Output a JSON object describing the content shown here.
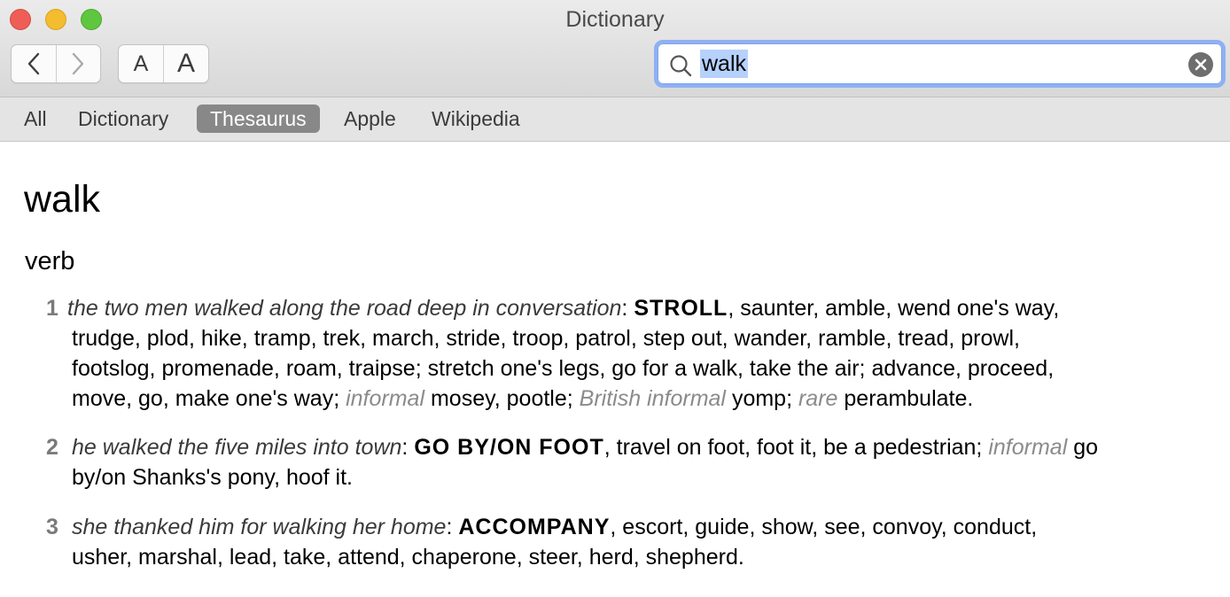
{
  "window": {
    "title": "Dictionary"
  },
  "toolbar": {
    "font_small_label": "A",
    "font_large_label": "A"
  },
  "search": {
    "value": "walk"
  },
  "tabs": [
    {
      "label": "All",
      "active": false
    },
    {
      "label": "Dictionary",
      "active": false
    },
    {
      "label": "Thesaurus",
      "active": true
    },
    {
      "label": "Apple",
      "active": false
    },
    {
      "label": "Wikipedia",
      "active": false
    }
  ],
  "entry": {
    "headword": "walk",
    "part_of_speech": "verb",
    "senses": [
      {
        "number": "1",
        "example": "the two men walked along the road deep in conversation",
        "core": "STROLL",
        "line1_rest": ", saunter, amble, wend one's way,",
        "line2": "trudge, plod, hike, tramp, trek, march, stride, troop, patrol, step out, wander, ramble, tread, prowl,",
        "line3": "footslog, promenade, roam, traipse; stretch one's legs, go for a walk, take the air; advance, proceed,",
        "line4_a": "move, go, make one's way;",
        "reg1": "informal",
        "line4_b": "mosey, pootle;",
        "reg2": "British informal",
        "line4_c": "yomp;",
        "reg3": "rare",
        "line4_d": "perambulate."
      },
      {
        "number": "2",
        "example": "he walked the five miles into town",
        "core": "GO BY/ON FOOT",
        "line1_rest": ", travel on foot, foot it, be a pedestrian;",
        "reg1": "informal",
        "line1_end": "go",
        "line2": "by/on Shanks's pony, hoof it."
      },
      {
        "number": "3",
        "example": "she thanked him for walking her home",
        "core": "ACCOMPANY",
        "line1_rest": ", escort, guide, show, see, convoy, conduct,",
        "line2": "usher, marshal, lead, take, attend, chaperone, steer, herd, shepherd."
      }
    ]
  },
  "colors": {
    "search_focus_ring": "#8fb0f3",
    "selection_highlight": "#b5d1fc",
    "active_tab_bg": "#888888",
    "close_button": "#ee5e56",
    "minimize_button": "#f4bc2f",
    "zoom_button": "#5fc63f"
  }
}
